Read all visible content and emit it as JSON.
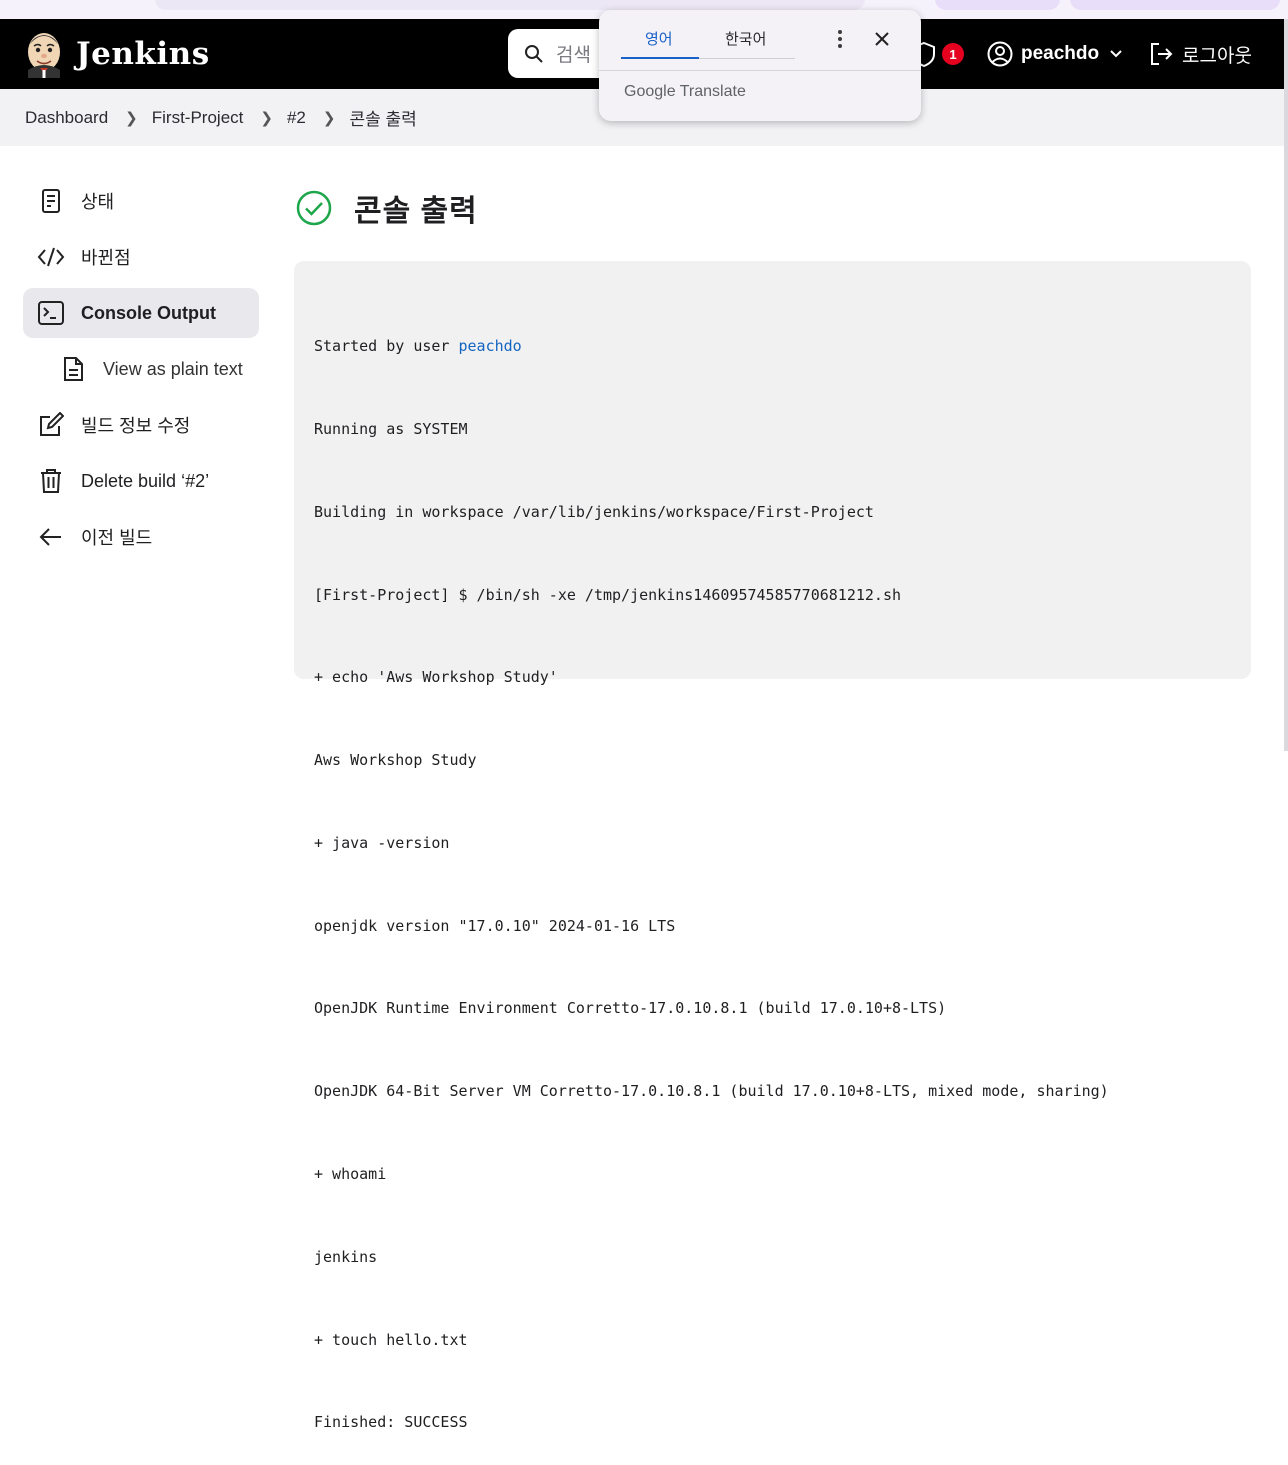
{
  "header": {
    "brand": "Jenkins",
    "search_placeholder": "검색",
    "security_badge_count": "1",
    "user": "peachdo",
    "logout": "로그아웃"
  },
  "breadcrumb": [
    "Dashboard",
    "First-Project",
    "#2",
    "콘솔 출력"
  ],
  "sidebar": {
    "items": [
      {
        "label": "상태",
        "icon": "status-icon"
      },
      {
        "label": "바뀐점",
        "icon": "code-icon"
      },
      {
        "label": "Console Output",
        "icon": "terminal-icon"
      },
      {
        "label": "View as plain text",
        "icon": "document-icon"
      },
      {
        "label": "빌드 정보 수정",
        "icon": "edit-icon"
      },
      {
        "label": "Delete build ‘#2’",
        "icon": "trash-icon"
      },
      {
        "label": "이전 빌드",
        "icon": "arrow-left-icon"
      }
    ]
  },
  "main": {
    "title": "콘솔 출력",
    "status_color": "#1ea64b",
    "console": {
      "started_prefix": "Started by user ",
      "started_user": "peachdo",
      "lines": [
        "Running as SYSTEM",
        "Building in workspace /var/lib/jenkins/workspace/First-Project",
        "[First-Project] $ /bin/sh -xe /tmp/jenkins14609574585770681212.sh",
        "+ echo 'Aws Workshop Study'",
        "Aws Workshop Study",
        "+ java -version",
        "openjdk version \"17.0.10\" 2024-01-16 LTS",
        "OpenJDK Runtime Environment Corretto-17.0.10.8.1 (build 17.0.10+8-LTS)",
        "OpenJDK 64-Bit Server VM Corretto-17.0.10.8.1 (build 17.0.10+8-LTS, mixed mode, sharing)",
        "+ whoami",
        "jenkins",
        "+ touch hello.txt",
        "Finished: SUCCESS"
      ]
    }
  },
  "translate_popup": {
    "tab_source": "영어",
    "tab_target": "한국어",
    "brand_google": "Google",
    "brand_translate": "Translate"
  }
}
